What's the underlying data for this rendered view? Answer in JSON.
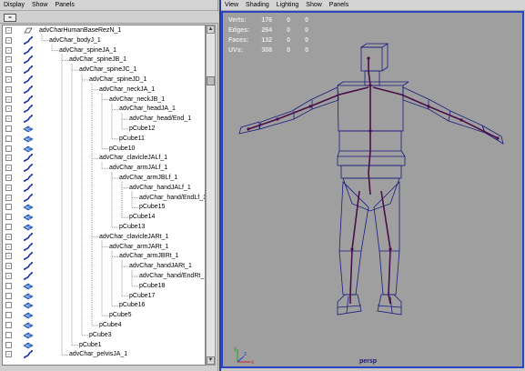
{
  "outliner": {
    "menu": [
      "Display",
      "Show",
      "Panels"
    ],
    "items": [
      {
        "label": "advCharHumanBaseRezN_1",
        "depth": 0,
        "icon": "transform",
        "expand": "-"
      },
      {
        "label": "advChar_bodyJ_1",
        "depth": 1,
        "icon": "joint",
        "expand": "-"
      },
      {
        "label": "advChar_spineJA_1",
        "depth": 2,
        "icon": "joint",
        "expand": "-"
      },
      {
        "label": "advChar_spineJB_1",
        "depth": 3,
        "icon": "joint",
        "expand": "-"
      },
      {
        "label": "advChar_spineJC_1",
        "depth": 4,
        "icon": "joint",
        "expand": "-"
      },
      {
        "label": "advChar_spineJD_1",
        "depth": 5,
        "icon": "joint",
        "expand": "-"
      },
      {
        "label": "advChar_neckJA_1",
        "depth": 6,
        "icon": "joint",
        "expand": "-"
      },
      {
        "label": "advChar_neckJB_1",
        "depth": 7,
        "icon": "joint",
        "expand": "-"
      },
      {
        "label": "advChar_headJA_1",
        "depth": 8,
        "icon": "joint",
        "expand": "-"
      },
      {
        "label": "advChar_head/End_1",
        "depth": 9,
        "icon": "joint",
        "expand": "-"
      },
      {
        "label": "pCube12",
        "depth": 9,
        "icon": "mesh",
        "expand": ""
      },
      {
        "label": "pCube11",
        "depth": 8,
        "icon": "mesh",
        "expand": ""
      },
      {
        "label": "pCube10",
        "depth": 7,
        "icon": "mesh",
        "expand": ""
      },
      {
        "label": "advChar_clavicleJALf_1",
        "depth": 6,
        "icon": "joint",
        "expand": "-"
      },
      {
        "label": "advChar_armJALf_1",
        "depth": 7,
        "icon": "joint",
        "expand": "-"
      },
      {
        "label": "advChar_armJBLf_1",
        "depth": 8,
        "icon": "joint",
        "expand": "-"
      },
      {
        "label": "advChar_handJALf_1",
        "depth": 9,
        "icon": "joint",
        "expand": "-"
      },
      {
        "label": "advChar_hand/EndLf_1",
        "depth": 10,
        "icon": "joint",
        "expand": "-"
      },
      {
        "label": "pCube15",
        "depth": 10,
        "icon": "mesh",
        "expand": ""
      },
      {
        "label": "pCube14",
        "depth": 9,
        "icon": "mesh",
        "expand": ""
      },
      {
        "label": "pCube13",
        "depth": 8,
        "icon": "mesh",
        "expand": ""
      },
      {
        "label": "advChar_clavicleJARt_1",
        "depth": 6,
        "icon": "joint",
        "expand": "-"
      },
      {
        "label": "advChar_armJARt_1",
        "depth": 7,
        "icon": "joint",
        "expand": "-"
      },
      {
        "label": "advChar_armJBRt_1",
        "depth": 8,
        "icon": "joint",
        "expand": "-"
      },
      {
        "label": "advChar_handJARt_1",
        "depth": 9,
        "icon": "joint",
        "expand": "-"
      },
      {
        "label": "advChar_hand/EndRt_1",
        "depth": 10,
        "icon": "joint",
        "expand": "-"
      },
      {
        "label": "pCube18",
        "depth": 10,
        "icon": "mesh",
        "expand": ""
      },
      {
        "label": "pCube17",
        "depth": 9,
        "icon": "mesh",
        "expand": ""
      },
      {
        "label": "pCube16",
        "depth": 8,
        "icon": "mesh",
        "expand": ""
      },
      {
        "label": "pCube5",
        "depth": 7,
        "icon": "mesh",
        "expand": ""
      },
      {
        "label": "pCube4",
        "depth": 6,
        "icon": "mesh",
        "expand": ""
      },
      {
        "label": "pCube3",
        "depth": 5,
        "icon": "mesh",
        "expand": ""
      },
      {
        "label": "pCube1",
        "depth": 4,
        "icon": "mesh",
        "expand": ""
      },
      {
        "label": "advChar_pelvisJA_1",
        "depth": 3,
        "icon": "joint",
        "expand": "-"
      }
    ]
  },
  "viewport": {
    "menu": [
      "View",
      "Shading",
      "Lighting",
      "Show",
      "Panels"
    ],
    "hud": [
      {
        "name": "Verts:",
        "values": [
          "176",
          "0",
          "0"
        ]
      },
      {
        "name": "Edges:",
        "values": [
          "264",
          "0",
          "0"
        ]
      },
      {
        "name": "Faces:",
        "values": [
          "132",
          "0",
          "0"
        ]
      },
      {
        "name": "UVs:",
        "values": [
          "308",
          "0",
          "0"
        ]
      }
    ],
    "camera": "persp",
    "axis_labels": {
      "x": "x",
      "y": "y",
      "z": "z"
    }
  },
  "colors": {
    "wire": "#1a1a80",
    "joint": "#4a0e4a",
    "viewport_bg": "#9f9f9f",
    "panel_border": "#2c45c0"
  }
}
